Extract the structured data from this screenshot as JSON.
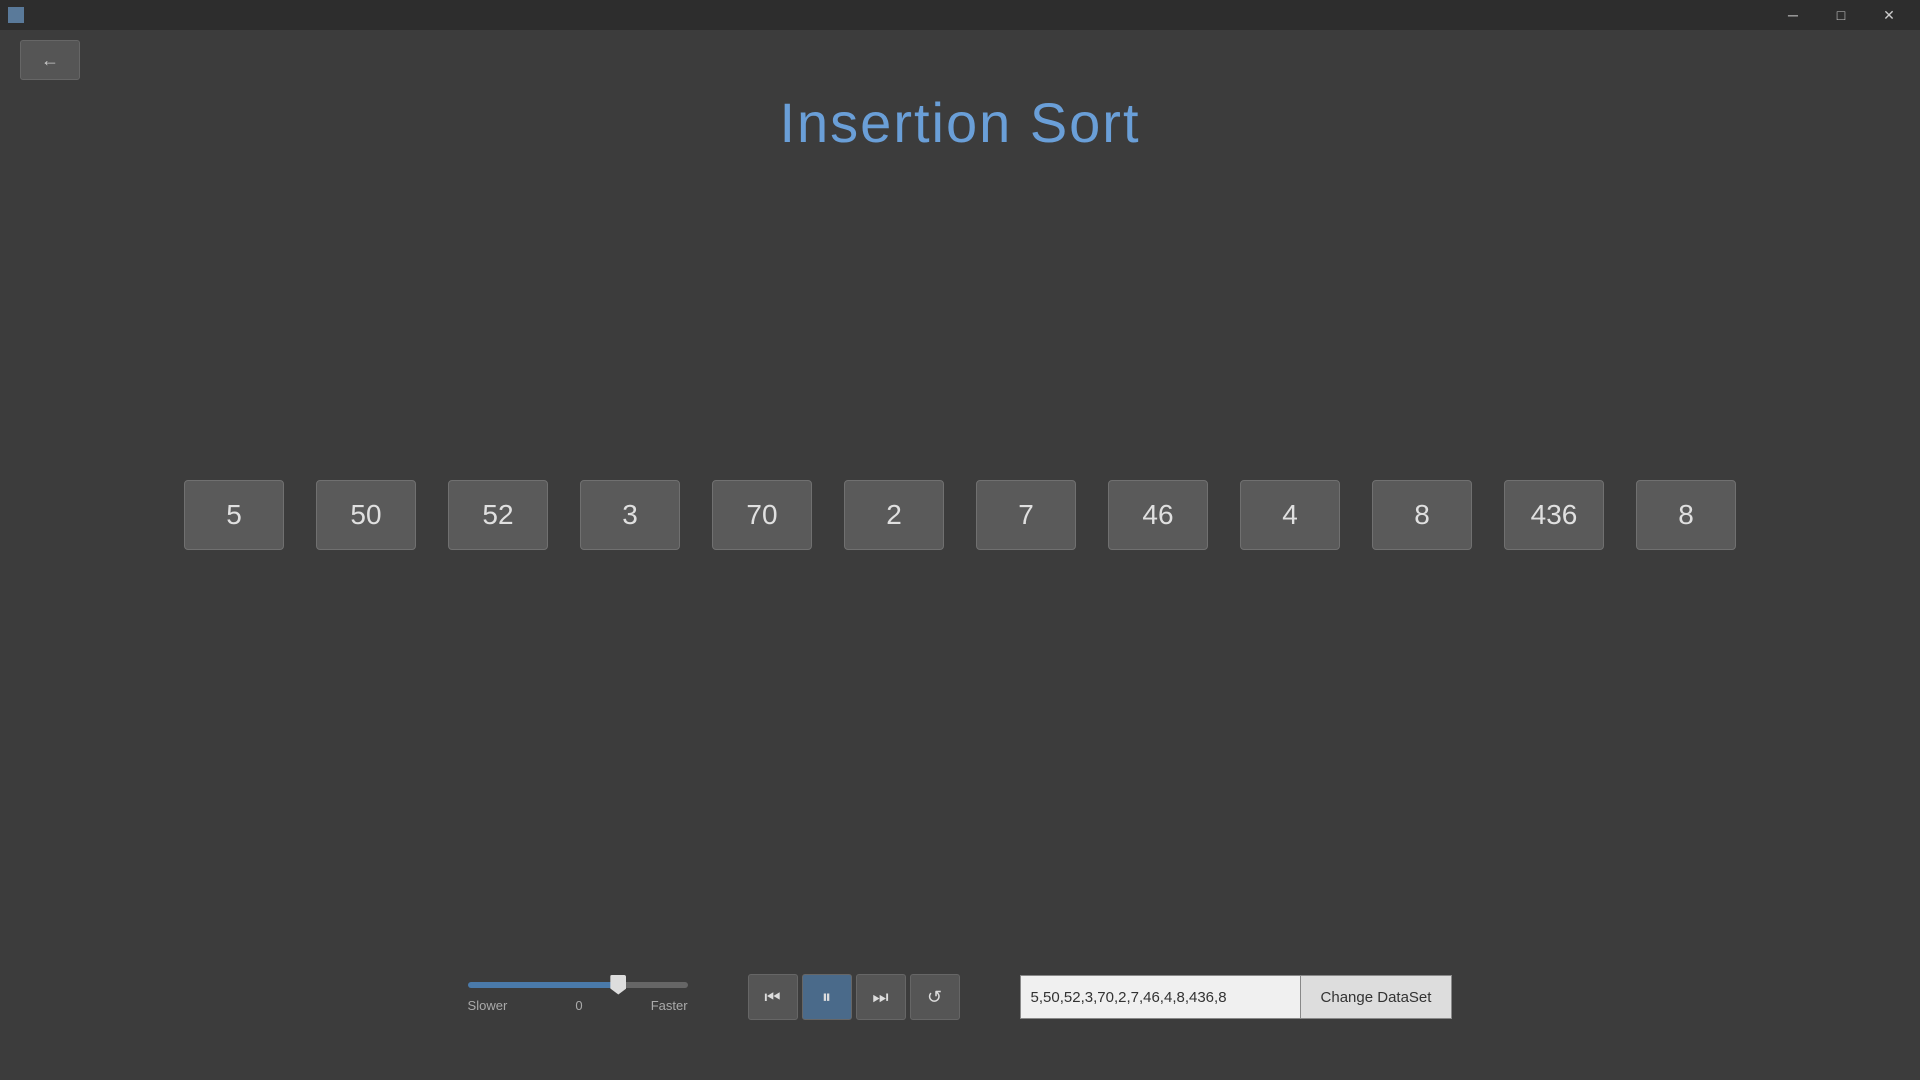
{
  "window": {
    "minimize_label": "─",
    "maximize_label": "□",
    "close_label": "✕"
  },
  "back_button": {
    "label": "←"
  },
  "title": "Insertion Sort",
  "array": {
    "elements": [
      5,
      50,
      52,
      3,
      70,
      2,
      7,
      46,
      4,
      8,
      436,
      8
    ]
  },
  "speed_control": {
    "min": 0,
    "max": 100,
    "value": 70,
    "label_slower": "Slower",
    "label_center": "0",
    "label_faster": "Faster"
  },
  "playback": {
    "rewind_label": "⏮",
    "pause_label": "⏸",
    "forward_label": "⏭",
    "reset_label": "↺"
  },
  "dataset": {
    "input_value": "5,50,52,3,70,2,7,46,4,8,436,8",
    "button_label": "Change DataSet"
  }
}
